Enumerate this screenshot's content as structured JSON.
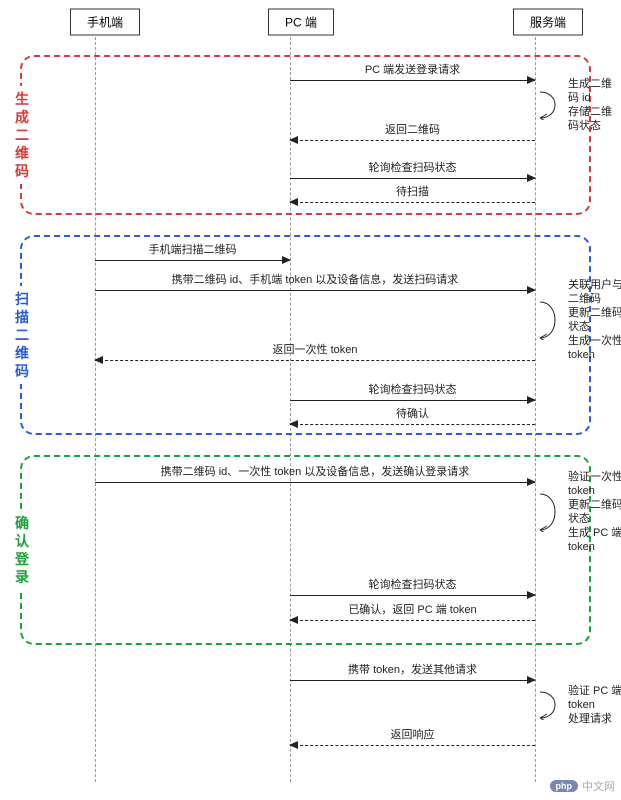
{
  "actors": {
    "mobile": "手机端",
    "pc": "PC 端",
    "server": "服务端"
  },
  "phases": {
    "gen": "生成二维码",
    "scan": "扫描二维码",
    "confirm": "确认登录"
  },
  "messages": {
    "p1_m1": "PC 端发送登录请求",
    "p1_self": "生成二维码 id\n存储二维码状态",
    "p1_m2": "返回二维码",
    "p1_m3": "轮询检查扫码状态",
    "p1_m4": "待扫描",
    "p2_m1": "手机端扫描二维码",
    "p2_m2": "携带二维码 id、手机端 token 以及设备信息，发送扫码请求",
    "p2_self": "关联用户与二维码\n更新二维码状态\n生成一次性 token",
    "p2_m3": "返回一次性 token",
    "p2_m4": "轮询检查扫码状态",
    "p2_m5": "待确认",
    "p3_m1": "携带二维码 id、一次性 token 以及设备信息，发送确认登录请求",
    "p3_self": "验证一次性 token\n更新二维码状态\n生成 PC 端 token",
    "p3_m2": "轮询检查扫码状态",
    "p3_m3": "已确认，返回 PC 端 token",
    "p4_m1": "携带 token，发送其他请求",
    "p4_self": "验证 PC 端 token\n处理请求",
    "p4_m2": "返回响应"
  },
  "watermark": {
    "badge": "php",
    "text": "中文网"
  }
}
